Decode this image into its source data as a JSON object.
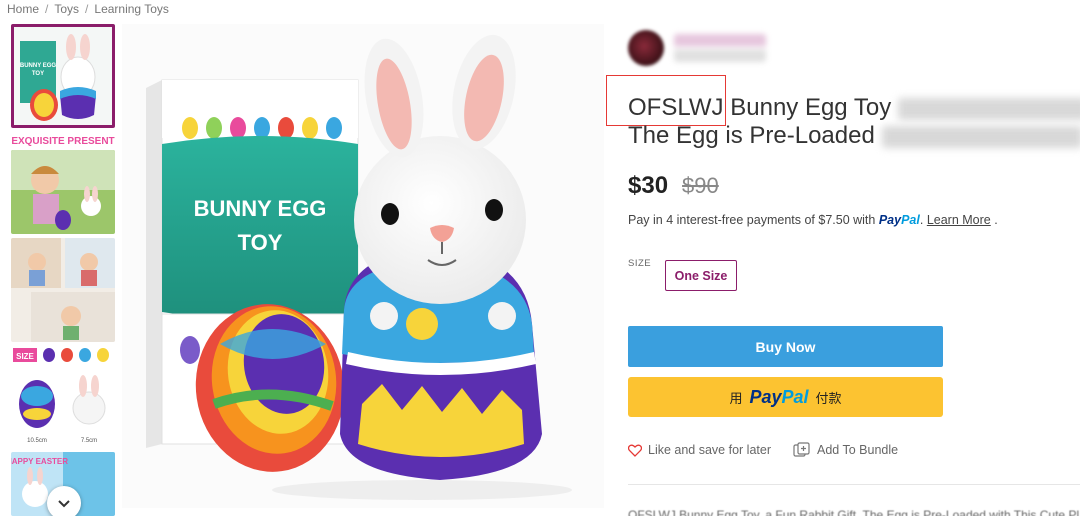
{
  "breadcrumb": [
    "Home",
    "Toys",
    "Learning Toys"
  ],
  "gallery": {
    "thumb_labels": {
      "banner": "EXQUISITE PRESENT",
      "size": "SIZE",
      "easter": "HAPPY EASTER",
      "size_cm_1": "10.5cm",
      "size_cm_2": "7.5cm"
    },
    "main_box_text": [
      "BUNNY EGG",
      "TOY"
    ]
  },
  "product": {
    "title_brand": "OFSLWJ",
    "title_visible_1": "Bunny Egg Toy",
    "title_visible_2": "The Egg is Pre-Loaded",
    "price": "$30",
    "original_price": "$90",
    "installments": {
      "text": "Pay in 4 interest-free payments of $7.50 with",
      "pay": "Pay",
      "pal": "Pal",
      "learn_more": "Learn More",
      "period": "."
    },
    "size": {
      "label": "SIZE",
      "option": "One Size"
    },
    "buy_now_label": "Buy Now",
    "paypal_button": {
      "prefix": "用",
      "pay": "Pay",
      "pal": "Pal",
      "suffix": "付款"
    },
    "actions": {
      "like": "Like and save for later",
      "bundle": "Add To Bundle"
    },
    "description_preview": "OFSLWJ Bunny Egg Toy, a Fun Rabbit Gift, The Egg is Pre-Loaded with This Cute Pl"
  },
  "colors": {
    "accent": "#8b1d6a",
    "buy_now": "#3a9fde",
    "paypal_yellow": "#fcc331",
    "highlight": "#e53935"
  }
}
